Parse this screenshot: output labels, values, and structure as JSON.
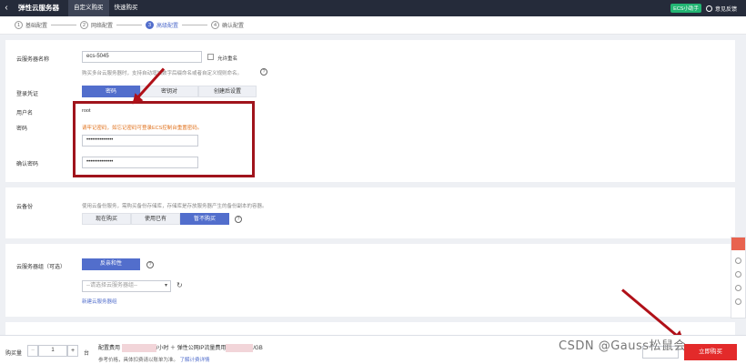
{
  "header": {
    "back_icon": "chevron-left-icon",
    "title": "弹性云服务器",
    "tabs": [
      {
        "label": "自定义购买"
      },
      {
        "label": "快速购买"
      }
    ],
    "badge": "ECS小助手",
    "feedback": "意见反馈"
  },
  "steps": [
    {
      "num": "1",
      "label": "基础配置"
    },
    {
      "num": "2",
      "label": "网络配置"
    },
    {
      "num": "3",
      "label": "高级配置"
    },
    {
      "num": "4",
      "label": "确认配置"
    }
  ],
  "server_name": {
    "label": "云服务器名称",
    "value": "ecs-5045",
    "allow_dup": "允许重名",
    "hint": "购买多台云服务器时，支持自动增加数字后缀命名或者自定义规则命名。"
  },
  "login": {
    "label": "登录凭证",
    "options": [
      "密码",
      "密钥对",
      "创建后设置"
    ],
    "username_label": "用户名",
    "username": "root",
    "password_label": "密码",
    "warning": "请牢记密码，如忘记密码可登录ECS控制台重置密码。",
    "password": "••••••••••••••",
    "confirm_label": "确认密码",
    "confirm": "••••••••••••••"
  },
  "backup": {
    "label": "云备份",
    "hint": "使用云备份服务，需购买备份存储库，存储库是存放服务器产生的备份副本的容器。",
    "options": [
      "现在购买",
      "使用已有",
      "暂不购买"
    ]
  },
  "group": {
    "label": "云服务器组（可选）",
    "button": "反亲和性",
    "select_placeholder": "--请选择云服务器组--",
    "new_link": "新建云服务器组"
  },
  "bottom": {
    "qty_label": "购买量",
    "minus": "−",
    "qty": "1",
    "plus": "+",
    "unit": "台",
    "fee_prefix": "配置费用",
    "fee_mid": "/小时 ＋ 弹性公网IP流量费用",
    "fee_suffix": "/GB",
    "note": "参考价格，具体扣费请以账单为准。",
    "note_link": "了解计费详情",
    "buy": "立即购买",
    "watermark": "CSDN @Gauss松鼠会"
  }
}
